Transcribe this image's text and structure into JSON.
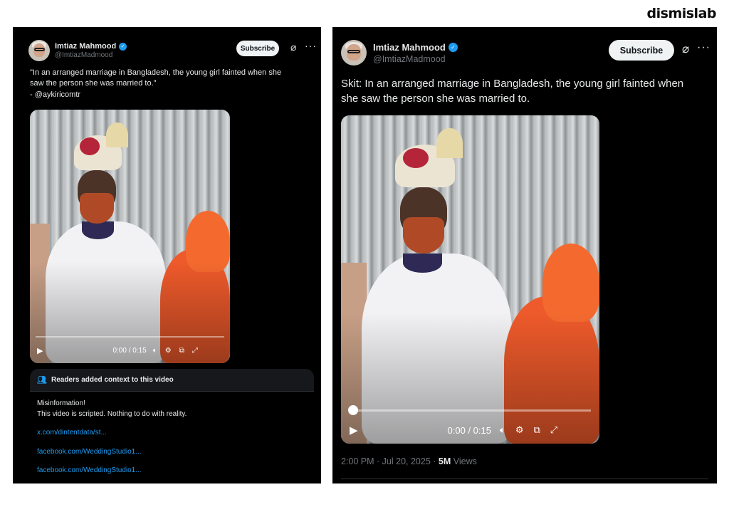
{
  "brand": "dismislab",
  "left_tweet": {
    "author_name": "Imtiaz Mahmood",
    "handle": "@ImtiazMadmood",
    "subscribe_label": "Subscribe",
    "text_line1": "\"In an arranged marriage in Bangladesh, the young girl fainted when she",
    "text_line2": "saw the person she was married to.\"",
    "text_line3": "- @aykiricomtr",
    "video": {
      "time": "0:00 / 0:15",
      "progress": 0.0
    },
    "community_note": {
      "header": "Readers added context to this video",
      "line1": "Misinformation!",
      "line2": "This video is scripted. Nothing to do with reality.",
      "links": [
        "x.com/dintentdata/st...",
        "facebook.com/WeddingStudio1...",
        "facebook.com/WeddingStudio1..."
      ]
    }
  },
  "right_tweet": {
    "author_name": "Imtiaz Mahmood",
    "handle": "@ImtiazMadmood",
    "subscribe_label": "Subscribe",
    "text_line1": "Skit: In an arranged marriage in Bangladesh, the young girl fainted when",
    "text_line2": "she saw the person she was married to.",
    "video": {
      "time": "0:00 / 0:15",
      "progress": 0.0
    },
    "timestamp": "2:00 PM · Jul 20, 2025 · ",
    "views_count": "5M",
    "views_label": " Views"
  },
  "icons": {
    "verified": "verified-badge-icon",
    "grok": "grok-icon",
    "more": "more-icon",
    "play": "play-icon",
    "volume": "volume-icon",
    "settings": "gear-icon",
    "pip": "pip-icon",
    "fullscreen": "fullscreen-icon",
    "readers": "people-icon"
  }
}
